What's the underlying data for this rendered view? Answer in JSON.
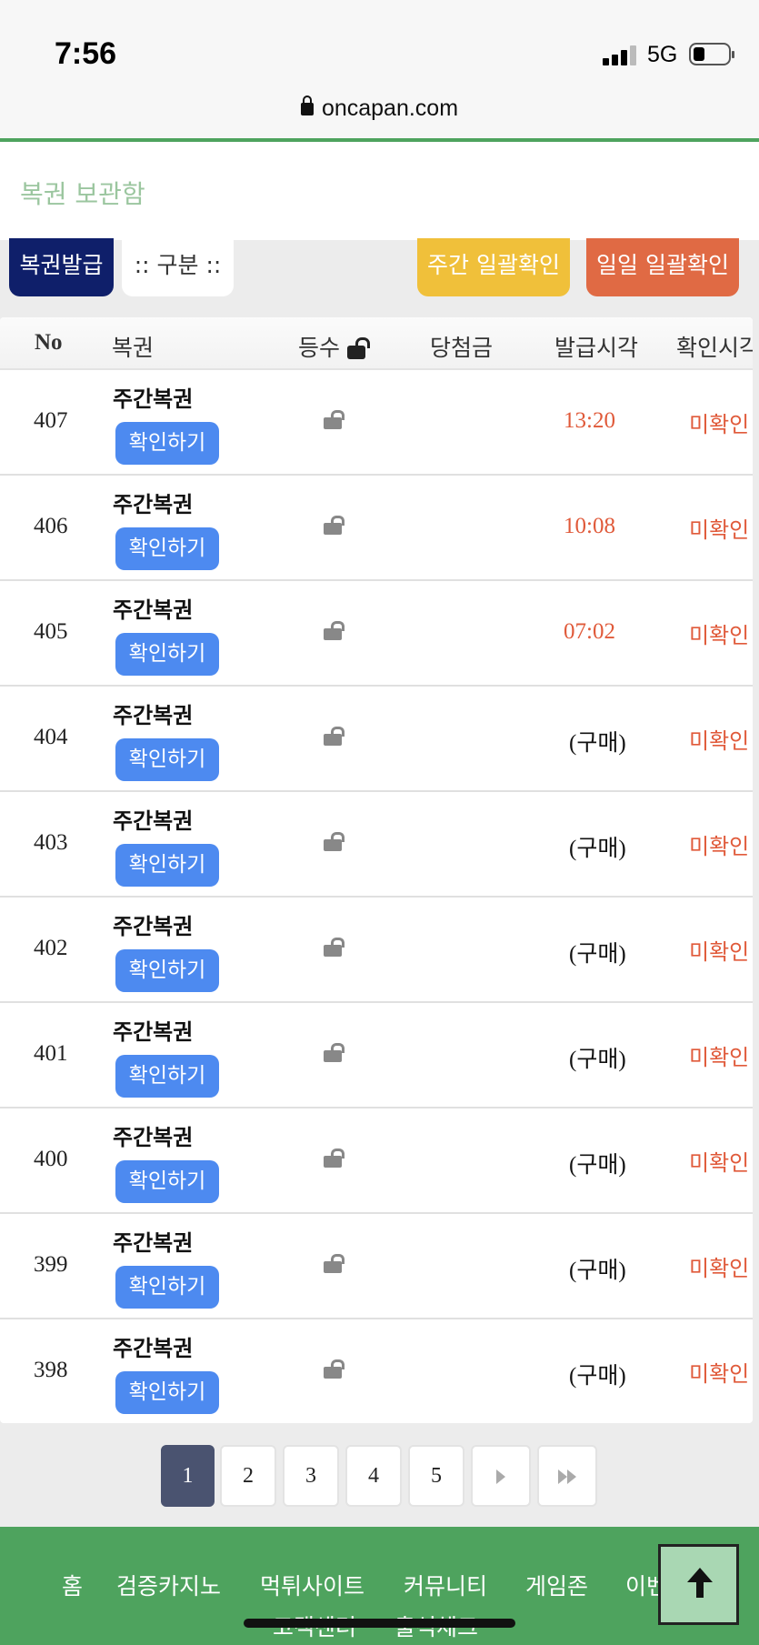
{
  "status_bar": {
    "time": "7:56",
    "network": "5G"
  },
  "browser": {
    "url": "oncapan.com"
  },
  "page": {
    "title": "복권 보관함"
  },
  "toolbar": {
    "issue_label": "복권발급",
    "filter_label": ":: 구분 ::",
    "weekly_confirm_label": "주간 일괄확인",
    "daily_confirm_label": "일일 일괄확인"
  },
  "table": {
    "headers": {
      "no": "No",
      "ticket": "복권",
      "rank": "등수",
      "prize": "당첨금",
      "issued": "발급시각",
      "confirmed": "확인시각"
    },
    "rows": [
      {
        "no": "407",
        "name": "주간복권",
        "button": "확인하기",
        "prize": "",
        "issued": "13:20",
        "status": "미확인"
      },
      {
        "no": "406",
        "name": "주간복권",
        "button": "확인하기",
        "prize": "",
        "issued": "10:08",
        "status": "미확인"
      },
      {
        "no": "405",
        "name": "주간복권",
        "button": "확인하기",
        "prize": "",
        "issued": "07:02",
        "status": "미확인"
      },
      {
        "no": "404",
        "name": "주간복권",
        "button": "확인하기",
        "prize": "",
        "issued": "(구매)",
        "status": "미확인"
      },
      {
        "no": "403",
        "name": "주간복권",
        "button": "확인하기",
        "prize": "",
        "issued": "(구매)",
        "status": "미확인"
      },
      {
        "no": "402",
        "name": "주간복권",
        "button": "확인하기",
        "prize": "",
        "issued": "(구매)",
        "status": "미확인"
      },
      {
        "no": "401",
        "name": "주간복권",
        "button": "확인하기",
        "prize": "",
        "issued": "(구매)",
        "status": "미확인"
      },
      {
        "no": "400",
        "name": "주간복권",
        "button": "확인하기",
        "prize": "",
        "issued": "(구매)",
        "status": "미확인"
      },
      {
        "no": "399",
        "name": "주간복권",
        "button": "확인하기",
        "prize": "",
        "issued": "(구매)",
        "status": "미확인"
      },
      {
        "no": "398",
        "name": "주간복권",
        "button": "확인하기",
        "prize": "",
        "issued": "(구매)",
        "status": "미확인"
      }
    ]
  },
  "pagination": {
    "pages": [
      "1",
      "2",
      "3",
      "4",
      "5"
    ],
    "current": "1"
  },
  "footer": {
    "nav": [
      "홈",
      "검증카지노",
      "먹튀사이트",
      "커뮤니티",
      "게임존",
      "이벤트"
    ],
    "nav2": [
      "고객센터",
      "출석체크"
    ]
  },
  "colors": {
    "accent_green": "#4ea35e",
    "issue_button": "#0f1f6a",
    "weekly_button": "#f0c03a",
    "daily_button": "#e06a44",
    "confirm_button": "#4d8af0",
    "status_red": "#e05a3a"
  }
}
